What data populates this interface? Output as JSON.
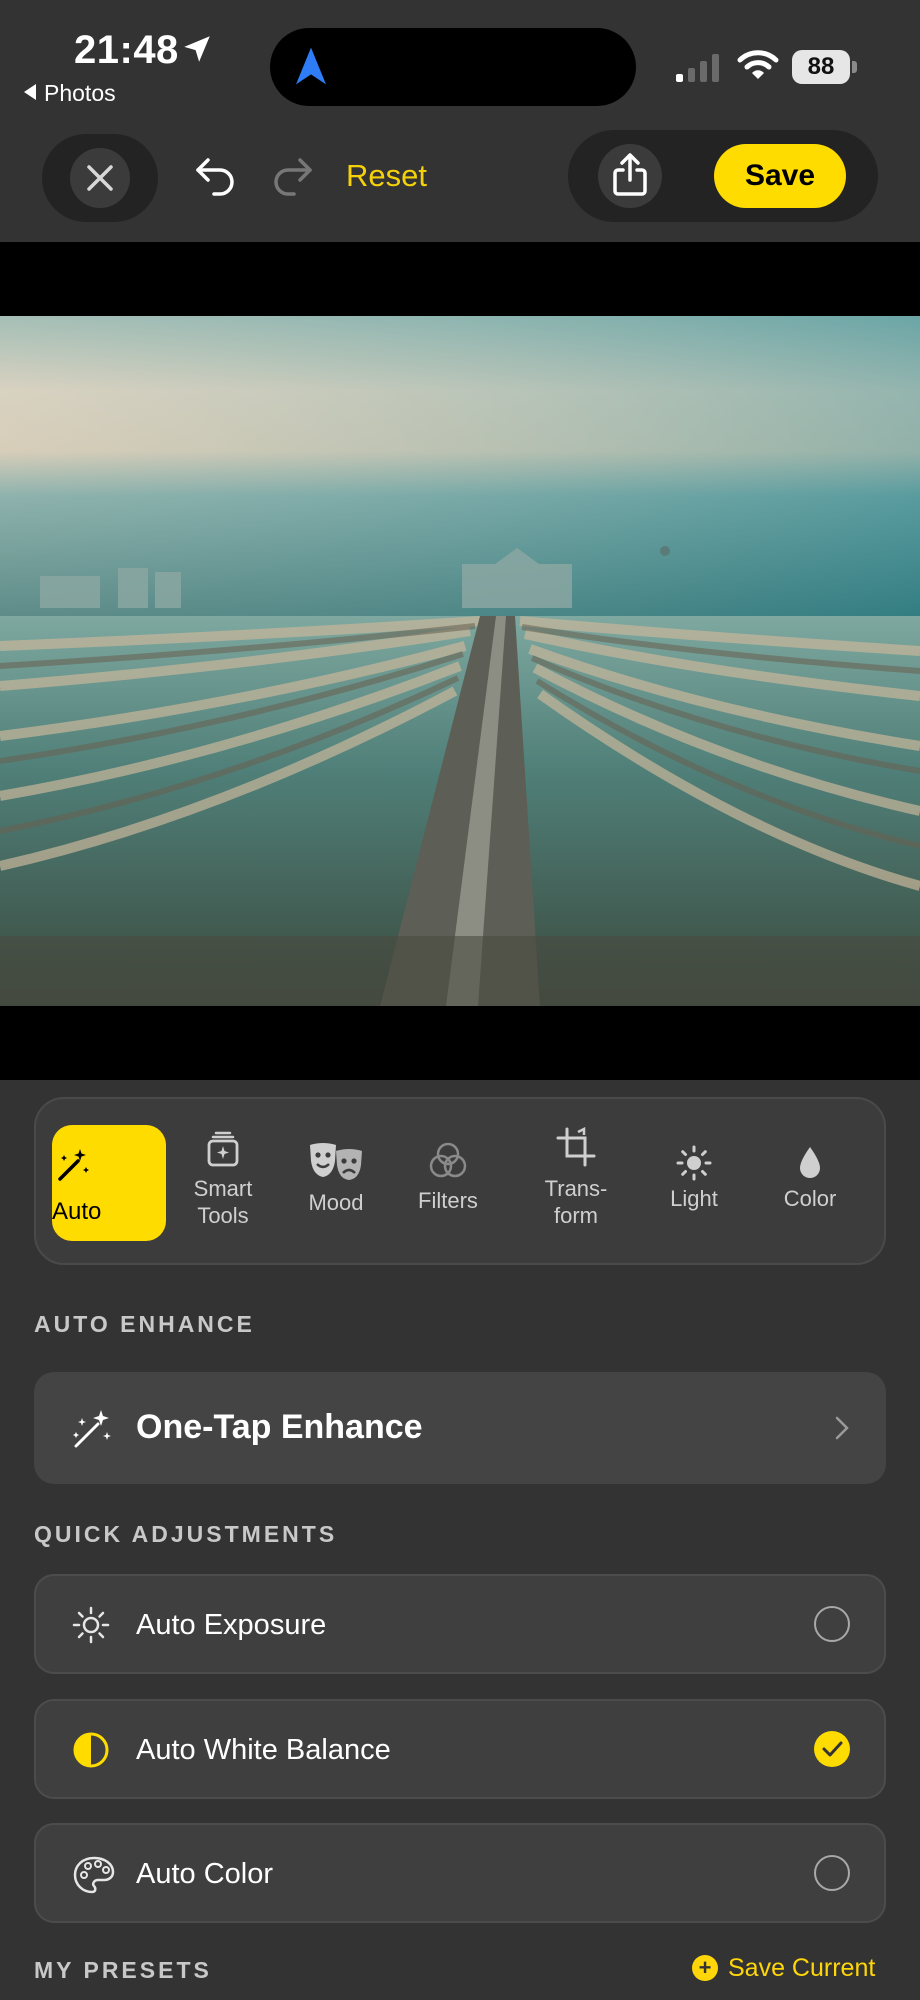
{
  "status_bar": {
    "time": "21:48",
    "back_app": "Photos",
    "battery": "88"
  },
  "toolbar": {
    "reset_label": "Reset",
    "save_label": "Save"
  },
  "tools": [
    {
      "label": "Auto",
      "icon": "magic-wand-icon",
      "active": true
    },
    {
      "label": "Smart\nTools",
      "icon": "smart-tools-icon"
    },
    {
      "label": "Mood",
      "icon": "theater-masks-icon"
    },
    {
      "label": "Filters",
      "icon": "filters-circles-icon"
    },
    {
      "label": "Trans-\nform",
      "icon": "crop-icon"
    },
    {
      "label": "Light",
      "icon": "sun-icon"
    },
    {
      "label": "Color",
      "icon": "drop-icon"
    }
  ],
  "auto_enhance": {
    "section_title": "AUTO ENHANCE",
    "one_tap_label": "One-Tap Enhance"
  },
  "quick_adjustments": {
    "section_title": "QUICK ADJUSTMENTS",
    "items": [
      {
        "label": "Auto Exposure",
        "icon": "sun-outline-icon",
        "checked": false
      },
      {
        "label": "Auto White Balance",
        "icon": "half-circle-icon",
        "checked": true
      },
      {
        "label": "Auto Color",
        "icon": "palette-icon",
        "checked": false
      }
    ]
  },
  "presets": {
    "section_title": "MY PRESETS",
    "save_current_label": "Save Current"
  },
  "colors": {
    "accent": "#ffdc00",
    "background": "#333333",
    "card": "#444444"
  }
}
